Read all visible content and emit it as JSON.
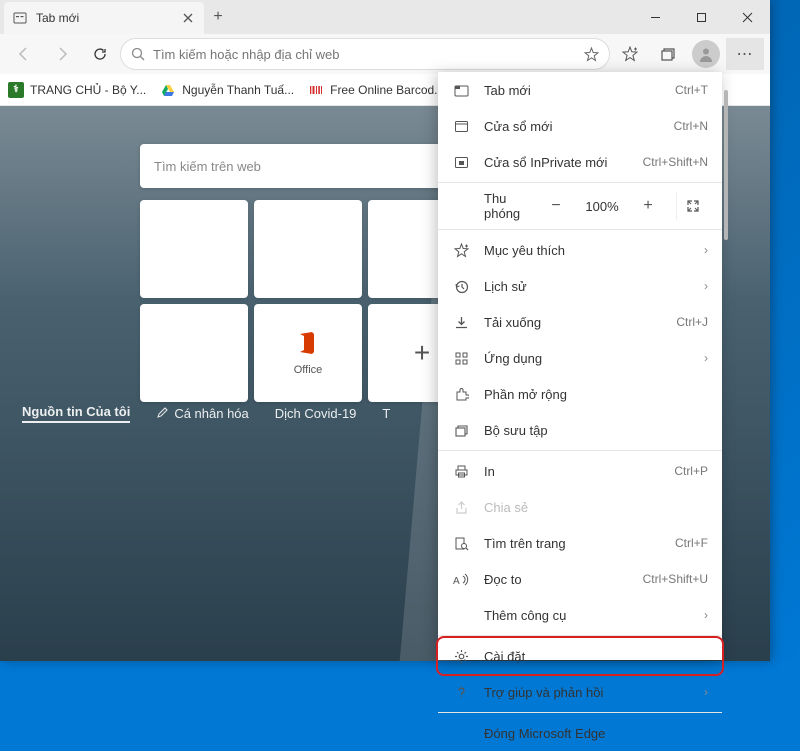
{
  "titlebar": {
    "tab_title": "Tab mới"
  },
  "toolbar": {
    "address_placeholder": "Tìm kiếm hoặc nhập địa chỉ web"
  },
  "bookmarks": [
    {
      "label": "TRANG CHỦ - Bộ Y...",
      "bg": "#2a7a2a",
      "fg": "#fff",
      "glyph": "⚕"
    },
    {
      "label": "Nguyễn Thanh Tuấ...",
      "bg": "#fff",
      "fg": "#0f9d58",
      "glyph": "▲"
    },
    {
      "label": "Free Online Barcod...",
      "bg": "#d9d9d9",
      "fg": "#d62f2f",
      "glyph": "▮"
    }
  ],
  "newtab": {
    "search_placeholder": "Tìm kiếm trên web",
    "tiles": {
      "office": "Office"
    },
    "newsbar": [
      "Nguồn tin Của tôi",
      "Cá nhân hóa",
      "Dịch Covid-19",
      "T"
    ]
  },
  "menu": {
    "new_tab": "Tab mới",
    "new_tab_sc": "Ctrl+T",
    "new_window": "Cửa sổ mới",
    "new_window_sc": "Ctrl+N",
    "inprivate": "Cửa sổ InPrivate mới",
    "inprivate_sc": "Ctrl+Shift+N",
    "zoom_label": "Thu phóng",
    "zoom_value": "100%",
    "favorites": "Mục yêu thích",
    "history": "Lịch sử",
    "downloads": "Tải xuống",
    "downloads_sc": "Ctrl+J",
    "apps": "Ứng dụng",
    "extensions": "Phần mở rộng",
    "collections": "Bộ sưu tập",
    "print": "In",
    "print_sc": "Ctrl+P",
    "share": "Chia sẻ",
    "find": "Tìm trên trang",
    "find_sc": "Ctrl+F",
    "readaloud": "Đọc to",
    "readaloud_sc": "Ctrl+Shift+U",
    "moretools": "Thêm công cụ",
    "settings": "Cài đặt",
    "help": "Trợ giúp và phản hồi",
    "close": "Đóng Microsoft Edge"
  }
}
